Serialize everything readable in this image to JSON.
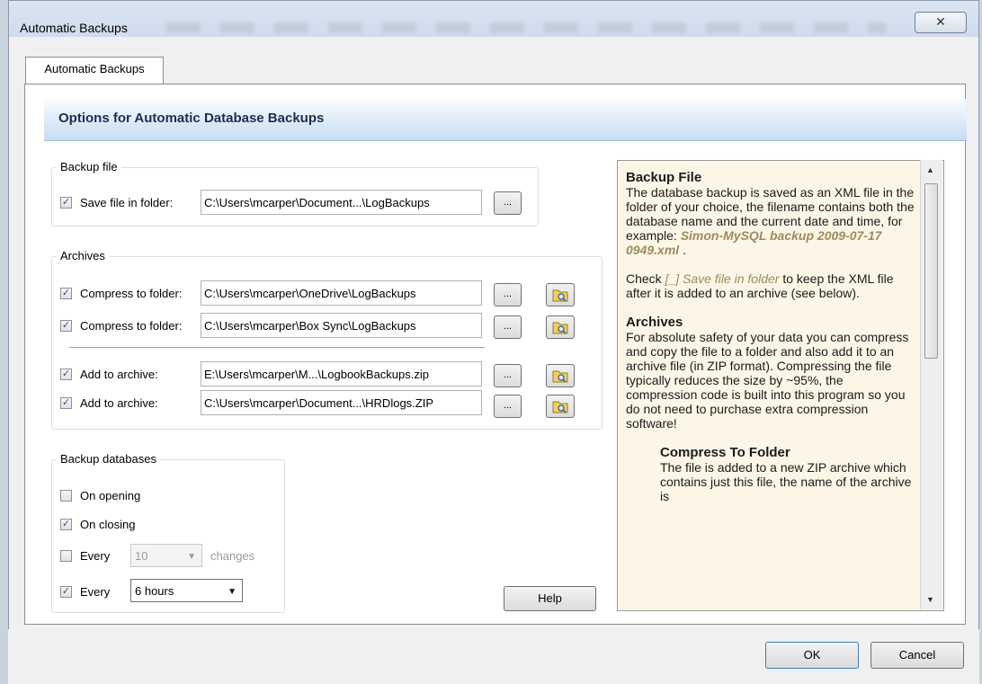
{
  "window": {
    "title": "Automatic Backups",
    "close_symbol": "✕"
  },
  "tab": {
    "label": "Automatic Backups"
  },
  "header": {
    "title": "Options for Automatic Database Backups"
  },
  "backup_file": {
    "group_label": "Backup file",
    "save_checked": true,
    "save_label": "Save file in folder:",
    "save_path": "C:\\Users\\mcarper\\Document...\\LogBackups",
    "browse_label": "..."
  },
  "archives": {
    "group_label": "Archives",
    "rows": [
      {
        "checked": true,
        "label": "Compress to folder:",
        "path": "C:\\Users\\mcarper\\OneDrive\\LogBackups",
        "browse": "..."
      },
      {
        "checked": true,
        "label": "Compress to folder:",
        "path": "C:\\Users\\mcarper\\Box Sync\\LogBackups",
        "browse": "..."
      },
      {
        "checked": true,
        "label": "Add to archive:",
        "path": "E:\\Users\\mcarper\\M...\\LogbookBackups.zip",
        "browse": "..."
      },
      {
        "checked": true,
        "label": "Add to archive:",
        "path": "C:\\Users\\mcarper\\Document...\\HRDlogs.ZIP",
        "browse": "..."
      }
    ]
  },
  "backup_databases": {
    "group_label": "Backup databases",
    "on_opening": {
      "checked": false,
      "label": "On opening"
    },
    "on_closing": {
      "checked": true,
      "label": "On closing"
    },
    "every_changes": {
      "checked": false,
      "label": "Every",
      "value": "10",
      "suffix": "changes"
    },
    "every_time": {
      "checked": true,
      "label": "Every",
      "value": "6 hours"
    }
  },
  "help_button": "Help",
  "help": {
    "h1": "Backup File",
    "p1": "The database backup is saved as an XML file in the folder of your choice, the filename contains both the database name and the current date and time, for example:",
    "p1_example": "Simon-MySQL backup 2009-07-17 0949.xml",
    "p1_end": ".",
    "p2_a": "Check",
    "p2_hint": "[_] Save file in folder",
    "p2_b": "to keep the XML file after it is added to an archive (see below).",
    "h2": "Archives",
    "p3": "For absolute safety of your data you can compress and copy the file to a folder and also add it to an archive file (in ZIP format). Compressing the file typically reduces the size by ~95%, the compression code is built into this program so you do not need to purchase extra compression software!",
    "h3": "Compress To Folder",
    "p4": "The file is added to a new ZIP archive which contains just this file, the name of the archive is"
  },
  "buttons": {
    "ok": "OK",
    "cancel": "Cancel"
  },
  "colors": {
    "header_gradient": "#c6dcf4",
    "help_background": "#fdf6e6",
    "hint_text": "#9d8a5f"
  },
  "icons": {
    "checkbox_checked": "✓",
    "dropdown": "▼",
    "scroll_up": "▲",
    "scroll_down": "▼"
  }
}
